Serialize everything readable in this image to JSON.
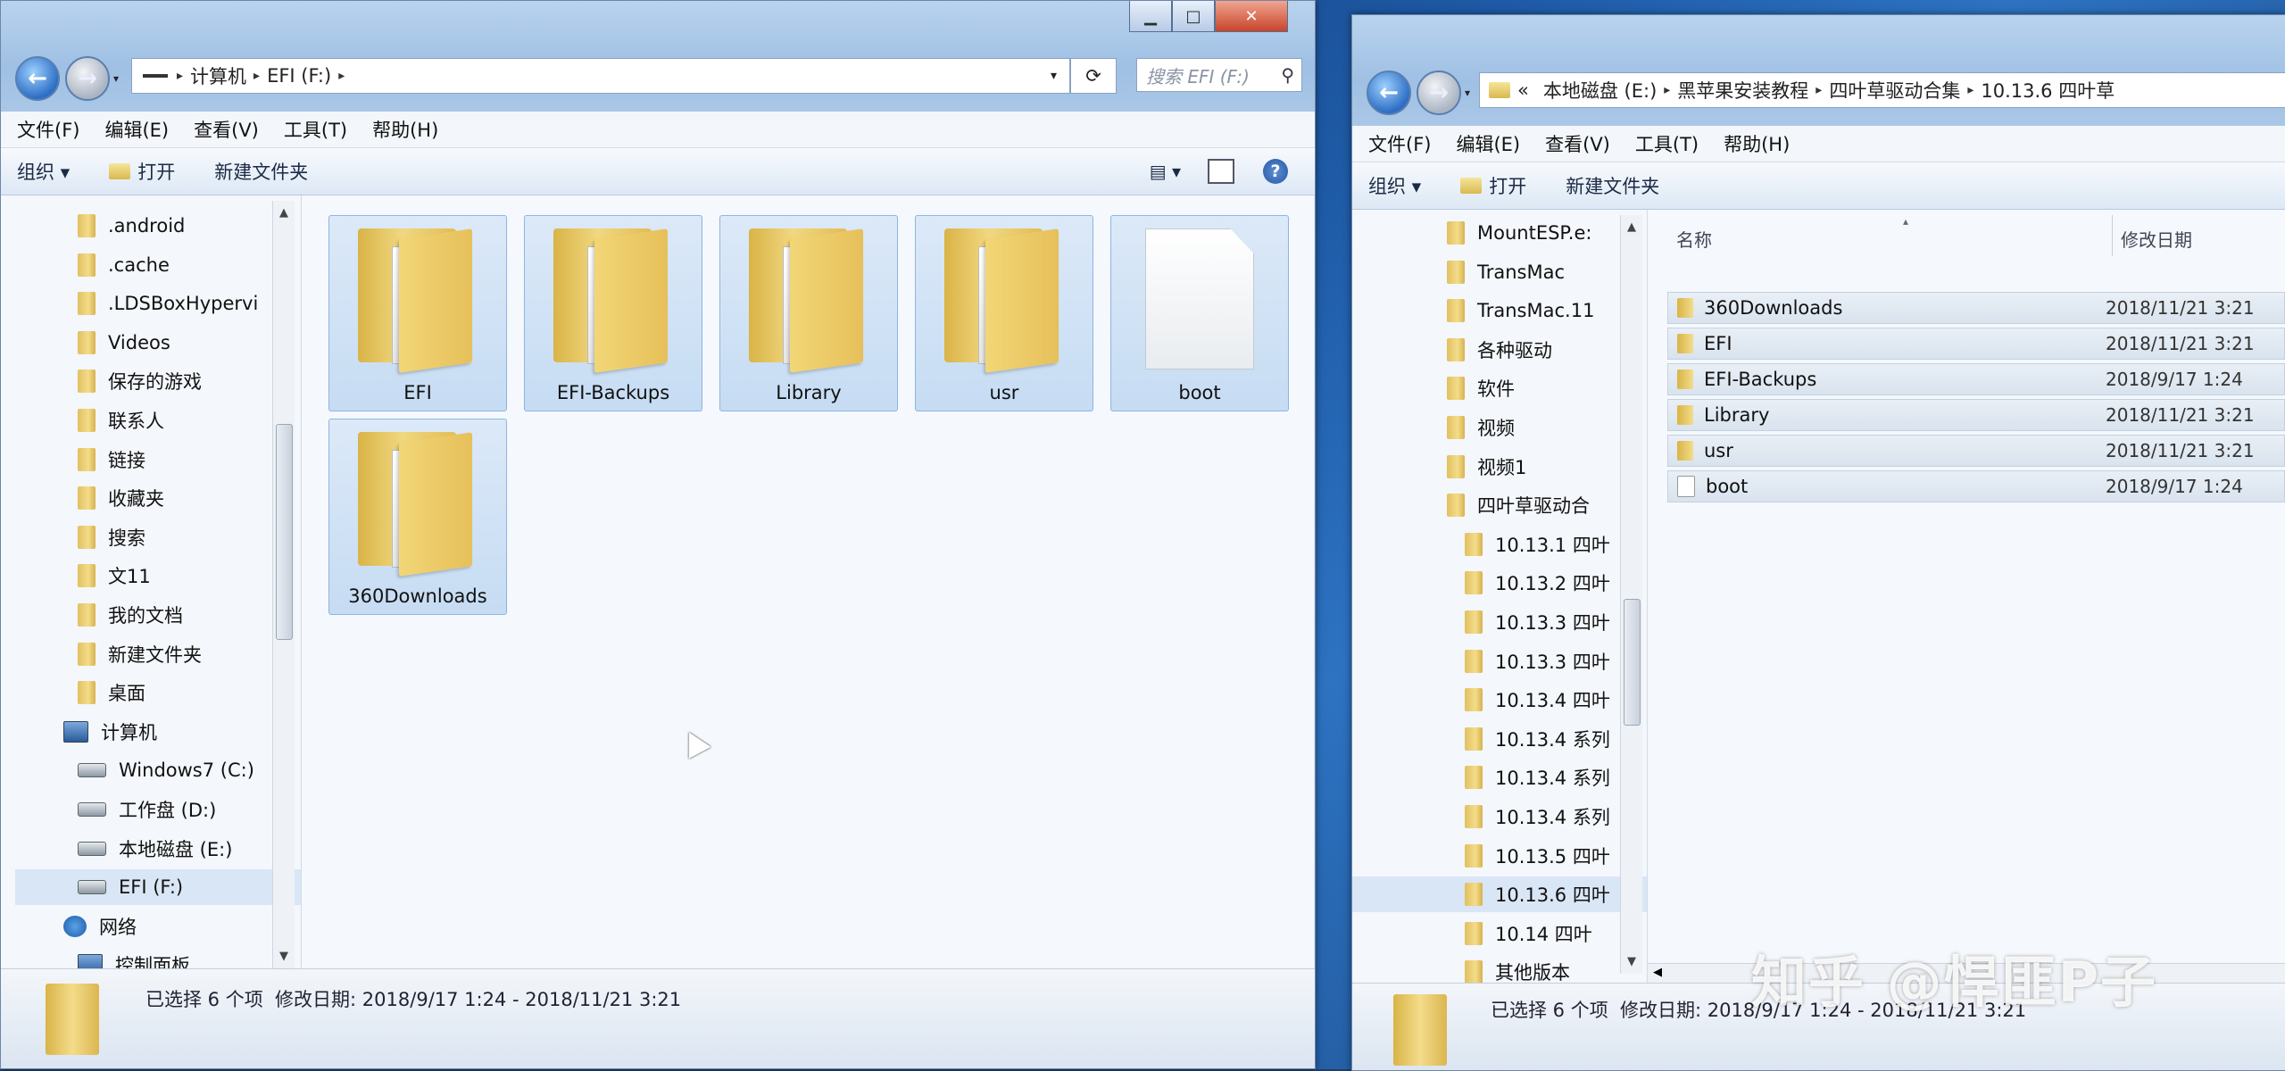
{
  "left_window": {
    "caption": {
      "minimize": "▁",
      "maximize": "□",
      "close": "✕"
    },
    "address": [
      "计算机",
      "EFI (F:)"
    ],
    "search_placeholder": "搜索 EFI (F:)",
    "menu": [
      "文件(F)",
      "编辑(E)",
      "查看(V)",
      "工具(T)",
      "帮助(H)"
    ],
    "commands": {
      "organize": "组织 ▾",
      "open": "打开",
      "new_folder": "新建文件夹",
      "help": "?"
    },
    "nav_items": [
      {
        "label": ".android",
        "icon": "folder"
      },
      {
        "label": ".cache",
        "icon": "folder"
      },
      {
        "label": ".LDSBoxHypervi",
        "icon": "folder"
      },
      {
        "label": "Videos",
        "icon": "folder"
      },
      {
        "label": "保存的游戏",
        "icon": "folder"
      },
      {
        "label": "联系人",
        "icon": "folder"
      },
      {
        "label": "链接",
        "icon": "folder"
      },
      {
        "label": "收藏夹",
        "icon": "folder"
      },
      {
        "label": "搜索",
        "icon": "folder"
      },
      {
        "label": "文11",
        "icon": "folder"
      },
      {
        "label": "我的文档",
        "icon": "folder"
      },
      {
        "label": "新建文件夹",
        "icon": "folder"
      },
      {
        "label": "桌面",
        "icon": "folder"
      },
      {
        "label": "计算机",
        "icon": "computer"
      },
      {
        "label": "Windows7 (C:)",
        "icon": "drive"
      },
      {
        "label": "工作盘 (D:)",
        "icon": "drive"
      },
      {
        "label": "本地磁盘 (E:)",
        "icon": "drive"
      },
      {
        "label": "EFI (F:)",
        "icon": "drive"
      },
      {
        "label": "网络",
        "icon": "network"
      },
      {
        "label": "控制面板",
        "icon": "computer"
      }
    ],
    "tiles": [
      {
        "label": "EFI",
        "kind": "folder"
      },
      {
        "label": "EFI-Backups",
        "kind": "folder"
      },
      {
        "label": "Library",
        "kind": "folder"
      },
      {
        "label": "usr",
        "kind": "folder"
      },
      {
        "label": "boot",
        "kind": "file"
      },
      {
        "label": "360Downloads",
        "kind": "folder"
      }
    ],
    "status": "已选择 6 个项  修改日期: 2018/9/17 1:24 - 2018/11/21 3:21"
  },
  "right_window": {
    "address": [
      "«",
      "本地磁盘 (E:)",
      "黑苹果安装教程",
      "四叶草驱动合集",
      "10.13.6 四叶草"
    ],
    "menu": [
      "文件(F)",
      "编辑(E)",
      "查看(V)",
      "工具(T)",
      "帮助(H)"
    ],
    "commands": {
      "organize": "组织 ▾",
      "open": "打开",
      "new_folder": "新建文件夹"
    },
    "nav_items": [
      {
        "label": "MountESP.e:"
      },
      {
        "label": "TransMac"
      },
      {
        "label": "TransMac.11"
      },
      {
        "label": "各种驱动"
      },
      {
        "label": "软件"
      },
      {
        "label": "视频"
      },
      {
        "label": "视频1"
      },
      {
        "label": "四叶草驱动合"
      },
      {
        "label": "10.13.1 四叶"
      },
      {
        "label": "10.13.2 四叶"
      },
      {
        "label": "10.13.3 四叶"
      },
      {
        "label": "10.13.3 四叶"
      },
      {
        "label": "10.13.4 四叶"
      },
      {
        "label": "10.13.4 系列"
      },
      {
        "label": "10.13.4 系列"
      },
      {
        "label": "10.13.4 系列"
      },
      {
        "label": "10.13.5 四叶"
      },
      {
        "label": "10.13.6 四叶"
      },
      {
        "label": "10.14 四叶"
      },
      {
        "label": "其他版本"
      }
    ],
    "columns": {
      "name": "名称",
      "date": "修改日期"
    },
    "rows": [
      {
        "name": "360Downloads",
        "date": "2018/11/21 3:21",
        "kind": "folder"
      },
      {
        "name": "EFI",
        "date": "2018/11/21 3:21",
        "kind": "folder"
      },
      {
        "name": "EFI-Backups",
        "date": "2018/9/17 1:24",
        "kind": "folder"
      },
      {
        "name": "Library",
        "date": "2018/11/21 3:21",
        "kind": "folder"
      },
      {
        "name": "usr",
        "date": "2018/11/21 3:21",
        "kind": "folder"
      },
      {
        "name": "boot",
        "date": "2018/9/17 1:24",
        "kind": "file"
      }
    ],
    "status": "已选择 6 个项  修改日期: 2018/9/17 1:24 - 2018/11/21 3:21"
  },
  "watermark": "知乎 @悍匪P子"
}
